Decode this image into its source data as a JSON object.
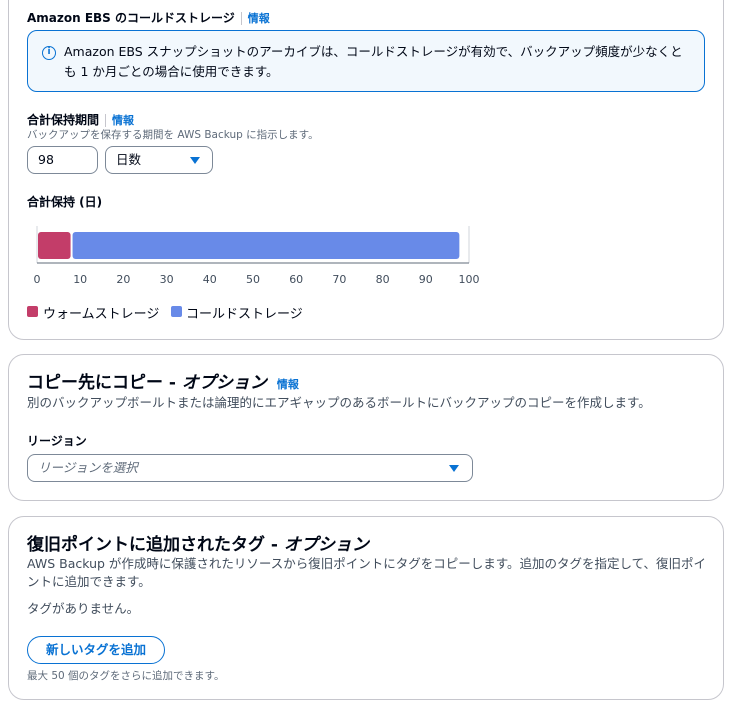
{
  "cold_storage": {
    "title": "Amazon EBS のコールドストレージ",
    "info_link": "情報",
    "alert_text": "Amazon EBS スナップショットのアーカイブは、コールドストレージが有効で、バックアップ頻度が少なくとも 1 か月ごとの場合に使用できます。",
    "info_icon": "info-icon"
  },
  "retention": {
    "label": "合計保持期間",
    "info_link": "情報",
    "description": "バックアップを保存する期間を AWS Backup に指示します。",
    "value": "98",
    "unit_selected": "日数"
  },
  "chart_data": {
    "type": "bar",
    "title": "合計保持 (日)",
    "orientation": "horizontal",
    "stacked": true,
    "xlim": [
      0,
      100
    ],
    "x_ticks": [
      "0",
      "10",
      "20",
      "30",
      "40",
      "50",
      "60",
      "70",
      "80",
      "90",
      "100"
    ],
    "series": [
      {
        "name": "ウォームストレージ",
        "color": "#c33d69",
        "start": 0,
        "end": 8
      },
      {
        "name": "コールドストレージ",
        "color": "#688ae8",
        "start": 8,
        "end": 98
      }
    ],
    "legend_position": "bottom-left"
  },
  "copy": {
    "title_main": "コピー先にコピー - ",
    "title_italic": "オプション",
    "info_link": "情報",
    "description": "別のバックアップボールトまたは論理的にエアギャップのあるボールトにバックアップのコピーを作成します。",
    "region_label": "リージョン",
    "region_placeholder": "リージョンを選択"
  },
  "tags": {
    "title_main": "復旧ポイントに追加されたタグ - ",
    "title_italic": "オプション",
    "description": "AWS Backup が作成時に保護されたリソースから復旧ポイントにタグをコピーします。追加のタグを指定して、復旧ポイントに追加できます。",
    "empty_text": "タグがありません。",
    "add_button": "新しいタグを追加",
    "limit_text": "最大 50 個のタグをさらに追加できます。"
  },
  "colors": {
    "accent": "#0972d3",
    "warm": "#c33d69",
    "cold": "#688ae8"
  }
}
